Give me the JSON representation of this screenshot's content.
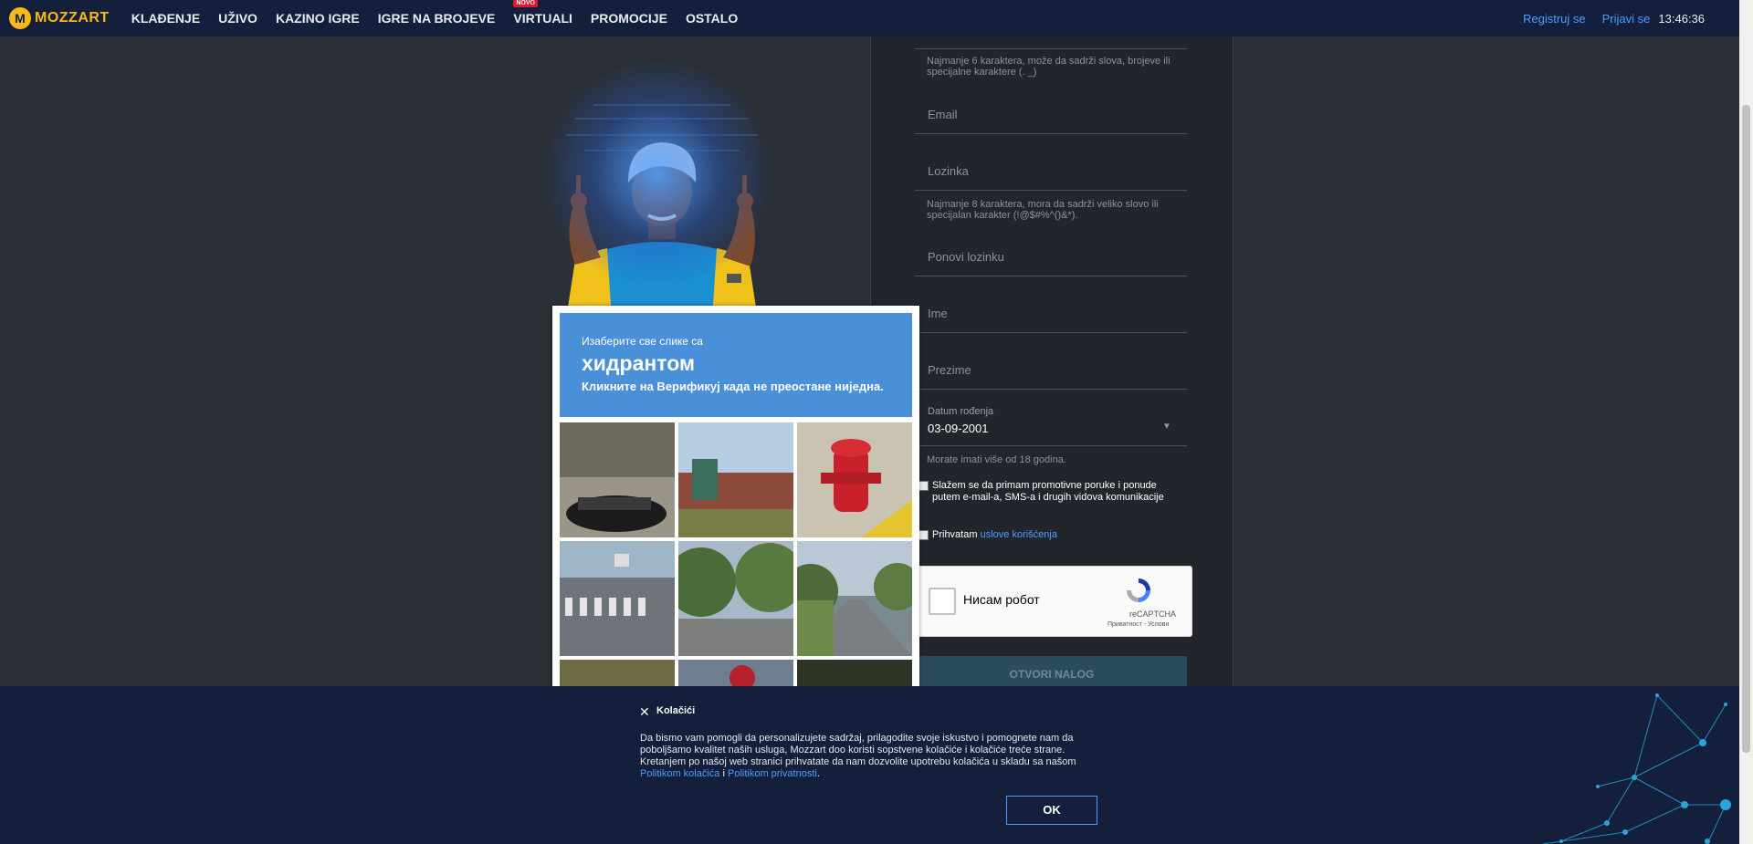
{
  "brand": {
    "logo_letter": "M",
    "name": "MOZZART",
    "color": "#f9b815"
  },
  "nav": {
    "items": [
      {
        "label": "KLAĐENJE"
      },
      {
        "label": "UŽIVO"
      },
      {
        "label": "KAZINO IGRE"
      },
      {
        "label": "IGRE NA BROJEVE"
      },
      {
        "label": "VIRTUALI",
        "badge": "NOVO"
      },
      {
        "label": "PROMOCIJE"
      },
      {
        "label": "OSTALO"
      }
    ],
    "register": "Registruj se",
    "login": "Prijavi se",
    "time": "13:46:36"
  },
  "form": {
    "username_hint": "Najmanje 6 karaktera, može da sadrži slova, brojeve ili specijalne karaktere (. _)",
    "email_placeholder": "Email",
    "password_placeholder": "Lozinka",
    "password_hint": "Najmanje 8 karaktera, mora da sadrži veliko slovo ili specijalan karakter (!@$#%^()&*).",
    "repeat_password_placeholder": "Ponovi lozinku",
    "first_name_placeholder": "Ime",
    "last_name_placeholder": "Prezime",
    "dob_label": "Datum rođenja",
    "dob_value": "03-09-2001",
    "age_hint": "Morate imati više od 18 godina.",
    "promo_consent": "Slažem se da primam promotivne poruke i ponude putem e-mail-a, SMS-a i drugih vidova komunikacije",
    "terms_prefix": "Prihvatam",
    "terms_link": "uslove korišćenja",
    "submit": "OTVORI NALOG"
  },
  "recaptcha": {
    "label": "Нисам робот",
    "brand": "reCAPTCHA",
    "links": "Приватност - Услови"
  },
  "captcha_popup": {
    "line1": "Изаберите све слике са",
    "line2": "хидрантом",
    "line3": "Кликните на Верификуј када не преостане ниједна.",
    "header_color": "#4a90d9",
    "tiles": [
      "car-street",
      "storefront",
      "fire-hydrant",
      "crosswalk",
      "tree-street",
      "road",
      "grass",
      "car-red",
      "trees-dark"
    ]
  },
  "cookie": {
    "title": "Kolačići",
    "body": "Da bismo vam pomogli da personalizujete sadržaj, prilagodite svoje iskustvo i pomognete nam da poboljšamo kvalitet naših usluga, Mozzart doo koristi sopstvene kolačiće i kolačiće treće strane. Kretanjem po našoj web stranici prihvatate da nam dozvolite upotrebu kolačića u skladu sa našom",
    "link1": "Politikom kolačića",
    "conjunction": "i",
    "link2": "Politikom privatnosti",
    "end": ".",
    "ok": "OK"
  }
}
